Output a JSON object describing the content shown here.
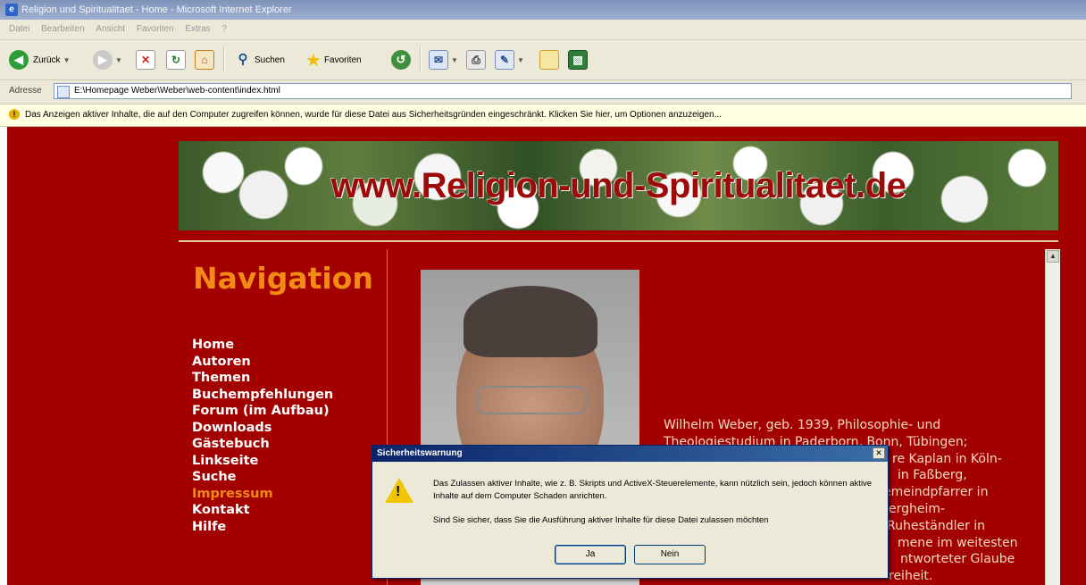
{
  "window": {
    "title": "Religion und Spiritualitaet - Home - Microsoft Internet Explorer"
  },
  "menu": [
    "Datei",
    "Bearbeiten",
    "Ansicht",
    "Favoriten",
    "Extras",
    "?"
  ],
  "toolbar": {
    "back_label": "Zurück",
    "search_label": "Suchen",
    "favorites_label": "Favoriten"
  },
  "address": {
    "label": "Adresse",
    "url": "E:\\Homepage Weber\\Weber\\web-content\\index.html"
  },
  "infobar": {
    "message": "Das Anzeigen aktiver Inhalte, die auf den Computer zugreifen können, wurde für diese Datei aus Sicherheitsgründen eingeschränkt. Klicken Sie hier, um Optionen anzuzeigen..."
  },
  "page": {
    "banner_text": "www.Religion-und-Spiritualitaet.de",
    "nav_heading": "Navigation",
    "nav_items": [
      {
        "label": "Home"
      },
      {
        "label": "Autoren"
      },
      {
        "label": "Themen"
      },
      {
        "label": "Buchempfehlungen"
      },
      {
        "label": "Forum (im Aufbau)"
      },
      {
        "label": "Downloads"
      },
      {
        "label": "Gästebuch"
      },
      {
        "label": "Linkseite"
      },
      {
        "label": "Suche"
      },
      {
        "label": "Impressum"
      },
      {
        "label": "Kontakt"
      },
      {
        "label": "Hilfe"
      }
    ],
    "active_nav": "Impressum",
    "bio_lines": [
      "Wilhelm Weber, geb. 1939, Philosophie- und",
      "Theologiestudium in Paderborn, Bonn, Tübingen;",
      "re Kaplan in Köln-",
      "in Faßberg,",
      "emeindpfarrer in",
      "ergheim-",
      "Ruheständler in",
      "mene im weitesten",
      "ntworteter Glaube",
      "reiheit."
    ]
  },
  "dialog": {
    "title": "Sicherheitswarnung",
    "message": "Das Zulassen aktiver Inhalte, wie z. B. Skripts und ActiveX-Steuerelemente, kann nützlich sein, jedoch können aktive Inhalte auf dem Computer Schaden anrichten.",
    "question": "Sind Sie sicher, dass Sie die Ausführung aktiver Inhalte für diese Datei zulassen möchten",
    "yes_label": "Ja",
    "no_label": "Nein"
  },
  "colors": {
    "page_background": "#a30000",
    "nav_heading": "#f28a16",
    "active_nav": "#f28a16"
  }
}
